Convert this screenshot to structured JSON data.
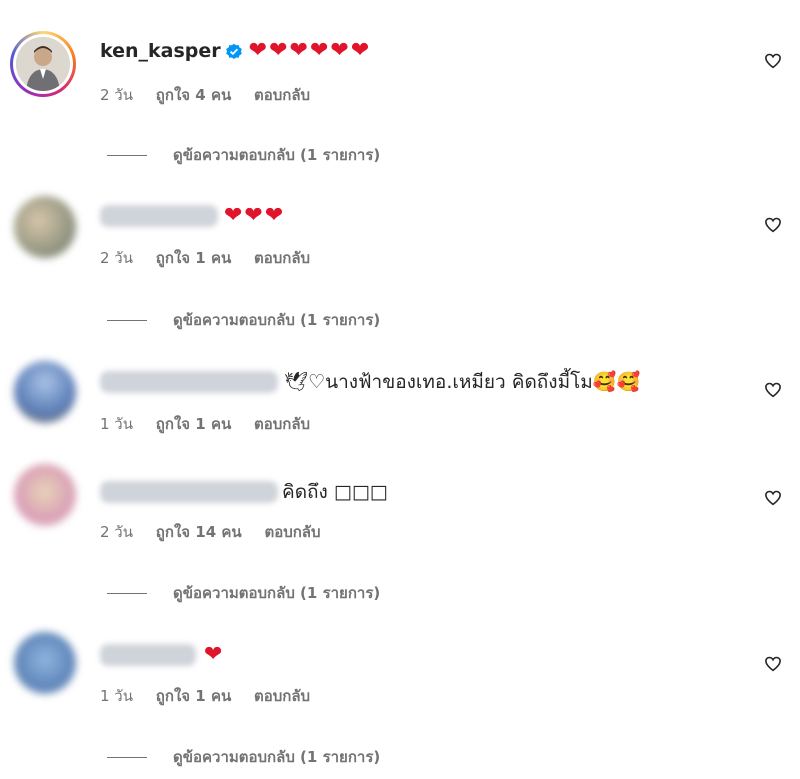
{
  "comments": [
    {
      "username": "ken_kasper",
      "verified": true,
      "text": "❤❤❤❤❤❤",
      "time": "2 วัน",
      "likes": "ถูกใจ 4 คน",
      "reply": "ตอบกลับ",
      "view_replies": "ดูข้อความตอบกลับ (1 รายการ)"
    },
    {
      "username": "",
      "text": "❤❤❤",
      "time": "2 วัน",
      "likes": "ถูกใจ 1 คน",
      "reply": "ตอบกลับ",
      "view_replies": "ดูข้อความตอบกลับ (1 รายการ)"
    },
    {
      "username": "",
      "text": "🕊♡นางฟ้าของเทอ.เหมียว คิดถึงมี้โม🥰🥰",
      "time": "1 วัน",
      "likes": "ถูกใจ 1 คน",
      "reply": "ตอบกลับ"
    },
    {
      "username": "",
      "text": "คิดถึง □□□",
      "time": "2 วัน",
      "likes": "ถูกใจ 14 คน",
      "reply": "ตอบกลับ",
      "view_replies": "ดูข้อความตอบกลับ (1 รายการ)"
    },
    {
      "username": "",
      "text": "❤",
      "time": "1 วัน",
      "likes": "ถูกใจ 1 คน",
      "reply": "ตอบกลับ",
      "view_replies": "ดูข้อความตอบกลับ (1 รายการ)"
    }
  ],
  "icons": {
    "like": "heart-outline-icon",
    "verified": "verified-badge-icon"
  },
  "colors": {
    "heart_red": "#e0142b",
    "meta_gray": "#737373",
    "verified_blue": "#0095f6"
  }
}
